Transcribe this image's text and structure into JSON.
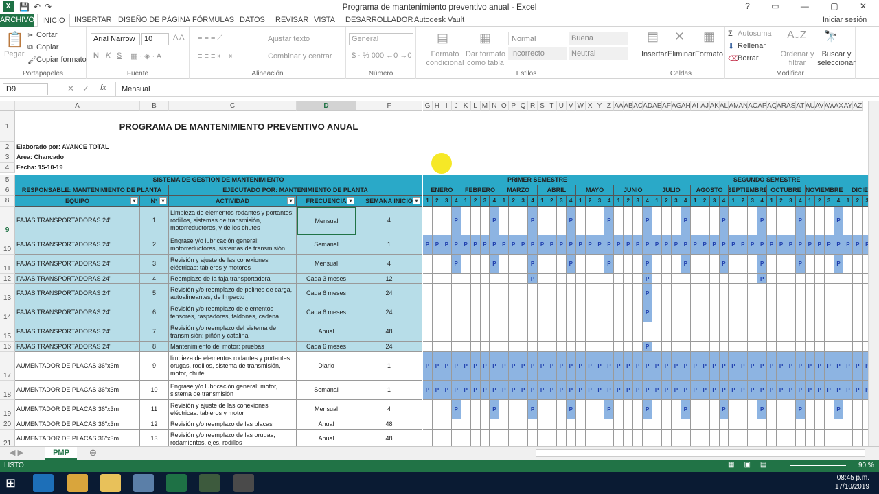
{
  "window": {
    "title": "Programa de mantenimiento preventivo anual - Excel",
    "controls": "? ▭ — ▢ ✕"
  },
  "menu": {
    "file": "ARCHIVO",
    "tabs": [
      "INICIO",
      "INSERTAR",
      "DISEÑO DE PÁGINA",
      "FÓRMULAS",
      "DATOS",
      "REVISAR",
      "VISTA",
      "DESARROLLADOR",
      "Autodesk Vault"
    ],
    "signin": "Iniciar sesión"
  },
  "ribbon": {
    "clipboard": {
      "paste": "Pegar",
      "cut": "Cortar",
      "copy": "Copiar",
      "painter": "Copiar formato",
      "label": "Portapapeles"
    },
    "font": {
      "name": "Arial Narrow",
      "size": "10",
      "label": "Fuente",
      "bold": "N",
      "italic": "K",
      "underline": "S"
    },
    "align": {
      "wrap": "Ajustar texto",
      "merge": "Combinar y centrar",
      "label": "Alineación"
    },
    "number": {
      "format": "General",
      "label": "Número"
    },
    "styles": {
      "cond": "Formato condicional",
      "table": "Dar formato como tabla",
      "normal": "Normal",
      "good": "Buena",
      "bad": "Incorrecto",
      "neutral": "Neutral",
      "label": "Estilos"
    },
    "cells": {
      "insert": "Insertar",
      "delete": "Eliminar",
      "format": "Formato",
      "label": "Celdas"
    },
    "edit": {
      "autosum": "Autosuma",
      "fill": "Rellenar",
      "clear": "Borrar",
      "sort": "Ordenar y filtrar",
      "find": "Buscar y seleccionar",
      "label": "Modificar"
    }
  },
  "formula": {
    "namebox": "D9",
    "content": "Mensual",
    "fx": "fx"
  },
  "columns": {
    "A": "A",
    "B": "B",
    "C": "C",
    "D": "D",
    "F": "F",
    "weeks": [
      "G",
      "H",
      "I",
      "J",
      "K",
      "L",
      "M",
      "N",
      "O",
      "P",
      "Q",
      "R",
      "S",
      "T",
      "U",
      "V",
      "W",
      "X",
      "Y",
      "Z",
      "AA",
      "AB",
      "AC",
      "AD",
      "AE",
      "AF",
      "AG",
      "AH",
      "AI",
      "AJ",
      "AK",
      "AL",
      "AM",
      "AN",
      "AO",
      "AP",
      "AQ",
      "AR",
      "AS",
      "AT",
      "AU",
      "AV",
      "AW",
      "AX",
      "AY",
      "AZ"
    ]
  },
  "sheet": {
    "title": "PROGRAMA DE MANTENIMIENTO PREVENTIVO ANUAL",
    "elaborado": "Elaborado por: AVANCE TOTAL",
    "area": "Area: Chancado",
    "fecha": "Fecha: 15-10-19",
    "sistema": "SISTEMA DE GESTION DE MANTENIMIENTO",
    "responsable": "RESPONSABLE: MANTENIMIENTO DE PLANTA",
    "ejecutado": "EJECUTADO POR: MANTENIMIENTO DE PLANTA",
    "sem1": "PRIMER SEMESTRE",
    "sem2": "SEGUNDO SEMESTRE",
    "months": [
      "ENERO",
      "FEBRERO",
      "MARZO",
      "ABRIL",
      "MAYO",
      "JUNIO",
      "JULIO",
      "AGOSTO",
      "SEPTIEMBRE",
      "OCTUBRE",
      "NOVIEMBRE",
      "DICIEM"
    ],
    "hdr": {
      "equipo": "EQUIPO",
      "n": "N°",
      "actividad": "ACTIVIDAD",
      "frecuencia": "FRECUENCIA",
      "semana": "SEMANA INICIO"
    },
    "weeknums": [
      "1",
      "2",
      "3",
      "4"
    ],
    "mark": "P",
    "rows": [
      {
        "num": "9",
        "equipo": "FAJAS TRANSPORTADORAS 24\"",
        "n": "1",
        "act": "Limpieza de elementos rodantes y portantes: rodillos, sistemas de transmisión, motorreductores, y de los chutes",
        "freq": "Mensual",
        "sem": "4"
      },
      {
        "num": "10",
        "equipo": "FAJAS TRANSPORTADORAS 24\"",
        "n": "2",
        "act": "Engrase y/o lubricación general: motorreductores, sistemas de transmisión",
        "freq": "Semanal",
        "sem": "1"
      },
      {
        "num": "11",
        "equipo": "FAJAS TRANSPORTADORAS 24\"",
        "n": "3",
        "act": "Revisión y ajuste de las conexiones eléctricas: tableros y motores",
        "freq": "Mensual",
        "sem": "4"
      },
      {
        "num": "12",
        "equipo": "FAJAS TRANSPORTADORAS 24\"",
        "n": "4",
        "act": "Reemplazo de la faja transportadora",
        "freq": "Cada 3 meses",
        "sem": "12"
      },
      {
        "num": "13",
        "equipo": "FAJAS TRANSPORTADORAS 24\"",
        "n": "5",
        "act": "Revisión y/o reemplazo de polines de carga, autoalineantes, de Impacto",
        "freq": "Cada 6 meses",
        "sem": "24"
      },
      {
        "num": "14",
        "equipo": "FAJAS TRANSPORTADORAS 24\"",
        "n": "6",
        "act": "Revisión y/o reemplazo de elementos tensores, raspadores, faldones, cadena",
        "freq": "Cada 6 meses",
        "sem": "24"
      },
      {
        "num": "15",
        "equipo": "FAJAS TRANSPORTADORAS 24\"",
        "n": "7",
        "act": "Revisión y/o reemplazo del sistema de transmisión: piñón y catalina",
        "freq": "Anual",
        "sem": "48"
      },
      {
        "num": "16",
        "equipo": "FAJAS TRANSPORTADORAS 24\"",
        "n": "8",
        "act": "Mantenimiento del motor: pruebas",
        "freq": "Cada 6 meses",
        "sem": "24"
      },
      {
        "num": "17",
        "equipo": "AUMENTADOR DE PLACAS 36\"x3m",
        "n": "9",
        "act": "limpieza de elementos rodantes y portantes: orugas, rodillos, sistema de transmisión, motor, chute",
        "freq": "Diario",
        "sem": "1"
      },
      {
        "num": "18",
        "equipo": "AUMENTADOR DE PLACAS 36\"x3m",
        "n": "10",
        "act": "Engrase y/o lubricación general: motor, sistema de transmisión",
        "freq": "Semanal",
        "sem": "1"
      },
      {
        "num": "19",
        "equipo": "AUMENTADOR DE PLACAS 36\"x3m",
        "n": "11",
        "act": "Revisión y ajuste de las conexiones eléctricas: tableros y motor",
        "freq": "Mensual",
        "sem": "4"
      },
      {
        "num": "20",
        "equipo": "AUMENTADOR DE PLACAS 36\"x3m",
        "n": "12",
        "act": "Revisión y/o reemplazo de las placas",
        "freq": "Anual",
        "sem": "48"
      },
      {
        "num": "21",
        "equipo": "AUMENTADOR DE PLACAS 36\"x3m",
        "n": "13",
        "act": "Revisión y/o reemplazo de las orugas, rodamientos, ejes, rodillos",
        "freq": "Anual",
        "sem": "48"
      }
    ]
  },
  "tabs": {
    "sheet": "PMP",
    "add": "⊕"
  },
  "status": {
    "ready": "LISTO",
    "zoom": "90 %"
  },
  "taskbar": {
    "time": "08:45 p.m.",
    "date": "17/10/2019"
  }
}
